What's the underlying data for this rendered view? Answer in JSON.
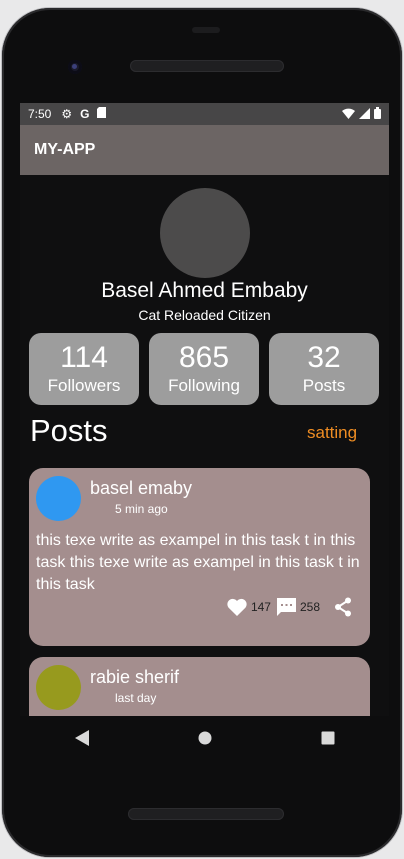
{
  "status_bar": {
    "time": "7:50",
    "icons": [
      "gear-icon",
      "google-icon",
      "sd-card-icon",
      "wifi-icon",
      "signal-icon",
      "battery-icon"
    ]
  },
  "app_bar": {
    "title": "MY-APP"
  },
  "profile": {
    "name": "Basel Ahmed Embaby",
    "subtitle": "Cat Reloaded Citizen"
  },
  "stats": [
    {
      "value": "114",
      "label": "Followers"
    },
    {
      "value": "865",
      "label": "Following"
    },
    {
      "value": "32",
      "label": "Posts"
    }
  ],
  "posts_section": {
    "title": "Posts",
    "setting_label": "satting"
  },
  "posts": [
    {
      "author": "basel emaby",
      "time": "5 min ago",
      "avatar_color": "#2f98f1",
      "body": "this texe write as exampel in this task t in this task this texe write as exampel in this task t in this task",
      "likes": "147",
      "comments": "258"
    },
    {
      "author": "rabie sherif",
      "time": "last day",
      "avatar_color": "#979a1e"
    }
  ],
  "colors": {
    "app_bar": "#6c6564",
    "card": "#a48e8e",
    "stat_box": "#9d9d9d",
    "accent": "#ef8d23"
  },
  "nav": [
    "back-icon",
    "home-icon",
    "recents-icon"
  ]
}
